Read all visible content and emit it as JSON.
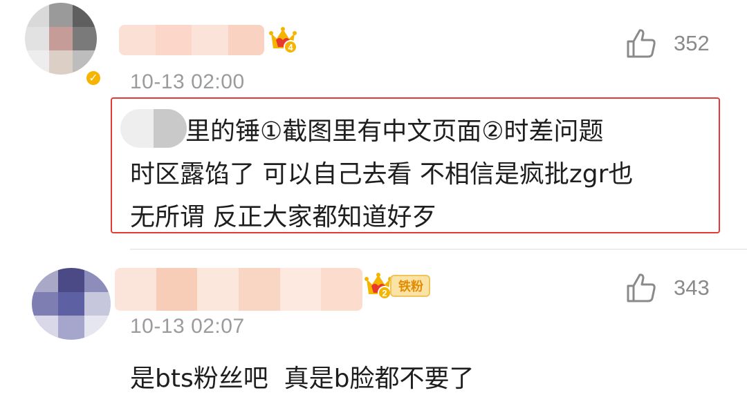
{
  "comments": [
    {
      "timestamp": "10-13 02:00",
      "likes": "352",
      "crown_level": "4",
      "verified": true,
      "avatar_icon": "blurred-avatar",
      "body_lines": [
        "里的锤①截图里有中文页面②时差问题",
        "时区露馅了 可以自己去看 不相信是疯批zgr也",
        "无所谓 反正大家都知道好歹"
      ],
      "highlight_color": "#e53935"
    },
    {
      "timestamp": "10-13 02:07",
      "likes": "343",
      "crown_level": "2",
      "fan_tag": "铁粉",
      "avatar_icon": "blurred-avatar",
      "body_lines": [
        "是bts粉丝吧  真是b脸都不要了"
      ]
    }
  ],
  "colors": {
    "timestamp": "#9b9b9b",
    "like_count": "#8a8a8a",
    "body_text": "#1e1e1e",
    "crown": "#e8392c",
    "crown_gold": "#f5b400",
    "fan_tag_text": "#e38b00"
  }
}
